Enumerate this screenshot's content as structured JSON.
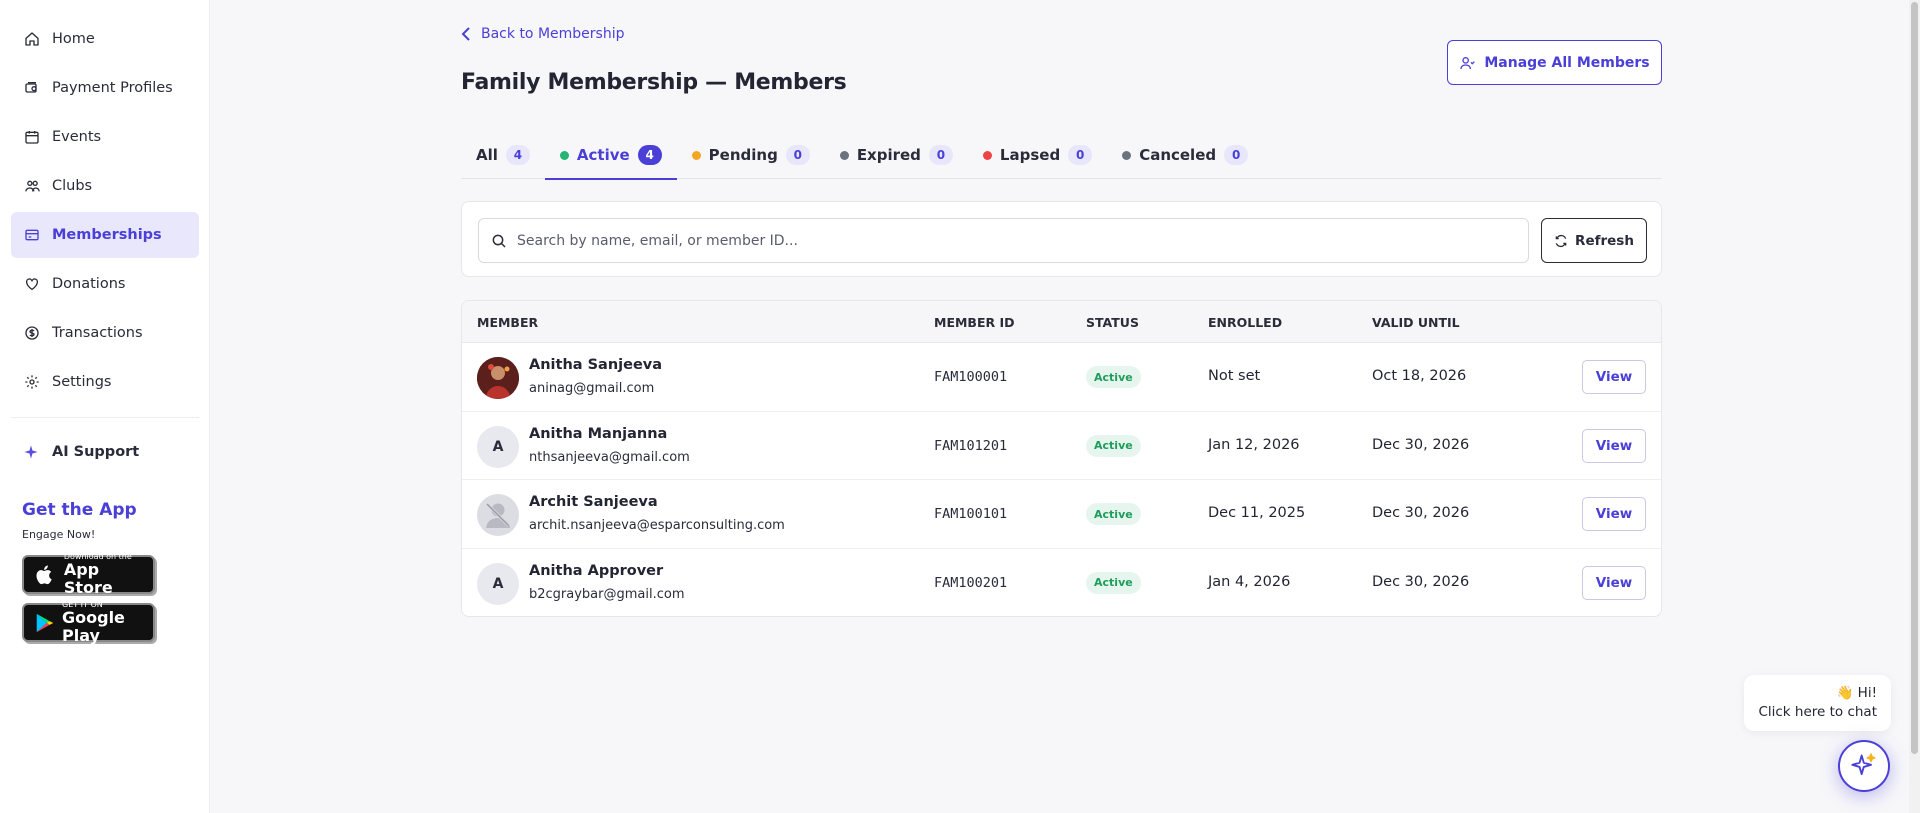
{
  "sidebar": {
    "items": [
      {
        "label": "Home",
        "icon": "home-icon"
      },
      {
        "label": "Payment Profiles",
        "icon": "payment-profile-icon"
      },
      {
        "label": "Events",
        "icon": "calendar-icon"
      },
      {
        "label": "Clubs",
        "icon": "users-group-icon"
      },
      {
        "label": "Memberships",
        "icon": "membership-card-icon",
        "active": true
      },
      {
        "label": "Donations",
        "icon": "heart-icon"
      },
      {
        "label": "Transactions",
        "icon": "dollar-icon"
      },
      {
        "label": "Settings",
        "icon": "gear-icon"
      }
    ],
    "ai_support": "AI Support",
    "get_app": "Get the App",
    "engage": "Engage Now!",
    "app_store": {
      "small": "Download on the",
      "big": "App Store"
    },
    "google_play": {
      "small": "GET IT ON",
      "big": "Google Play"
    }
  },
  "header": {
    "back_label": "Back to Membership",
    "title": "Family Membership — Members",
    "manage_label": "Manage All Members"
  },
  "tabs": [
    {
      "label": "All",
      "count": "4",
      "dot": null
    },
    {
      "label": "Active",
      "count": "4",
      "dot": "#22b573",
      "active": true
    },
    {
      "label": "Pending",
      "count": "0",
      "dot": "#f5a524"
    },
    {
      "label": "Expired",
      "count": "0",
      "dot": "#6b7280"
    },
    {
      "label": "Lapsed",
      "count": "0",
      "dot": "#ef4444"
    },
    {
      "label": "Canceled",
      "count": "0",
      "dot": "#6b7280"
    }
  ],
  "search": {
    "placeholder": "Search by name, email, or member ID...",
    "refresh_label": "Refresh"
  },
  "table": {
    "headers": {
      "member": "MEMBER",
      "member_id": "MEMBER ID",
      "status": "STATUS",
      "enrolled": "ENROLLED",
      "valid_until": "VALID UNTIL"
    },
    "view_label": "View",
    "rows": [
      {
        "name": "Anitha Sanjeeva",
        "email": "aninag@gmail.com",
        "id": "FAM100001",
        "status": "Active",
        "enrolled": "Not set",
        "valid_until": "Oct 18, 2026",
        "avatar": "photo"
      },
      {
        "name": "Anitha Manjanna",
        "email": "nthsanjeeva@gmail.com",
        "id": "FAM101201",
        "status": "Active",
        "enrolled": "Jan 12, 2026",
        "valid_until": "Dec 30, 2026",
        "avatar": "A"
      },
      {
        "name": "Archit Sanjeeva",
        "email": "archit.nsanjeeva@esparconsulting.com",
        "id": "FAM100101",
        "status": "Active",
        "enrolled": "Dec 11, 2025",
        "valid_until": "Dec 30, 2026",
        "avatar": "placeholder"
      },
      {
        "name": "Anitha Approver",
        "email": "b2cgraybar@gmail.com",
        "id": "FAM100201",
        "status": "Active",
        "enrolled": "Jan 4, 2026",
        "valid_until": "Dec 30, 2026",
        "avatar": "A"
      }
    ]
  },
  "chat": {
    "line1": "👋 Hi!",
    "line2": "Click here to chat"
  },
  "colors": {
    "accent": "#4a3fd6",
    "active_green": "#1f9d5c"
  }
}
